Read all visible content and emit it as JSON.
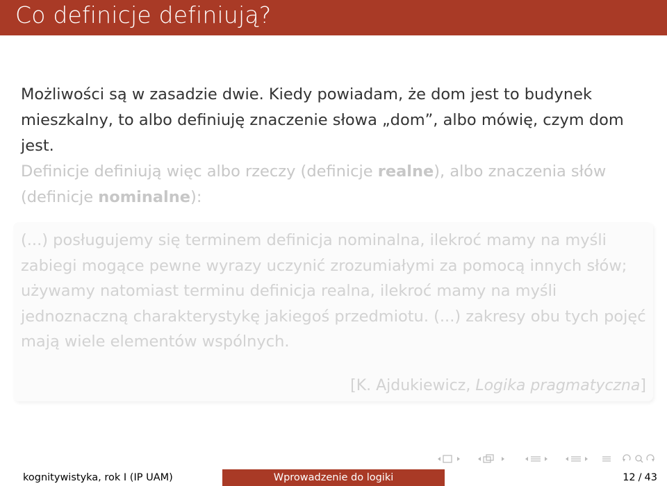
{
  "title": "Co definicje definiują?",
  "paragraph1": "Możliwości są w zasadzie dwie. Kiedy powiadam, że dom jest to budynek mieszkalny, to albo definiuję znaczenie słowa „dom”, albo mówię, czym dom jest.",
  "paragraph2": {
    "part1": "Definicje definiują więc albo rzeczy (definicje ",
    "bold1": "realne",
    "part2": "), albo znaczenia słów (definicje ",
    "bold2": "nominalne",
    "part3": "):"
  },
  "quote": {
    "text": "(...) posługujemy się terminem definicja nominalna, ilekroć mamy na myśli zabiegi mogące pewne wyrazy uczynić zrozumiałymi za pomocą innych słów; używamy natomiast terminu definicja realna, ilekroć mamy na myśli jednoznaczną charakterystykę jakiegoś przedmiotu. (...) zakresy obu tych pojęć mają wiele elementów wspólnych.",
    "source_prefix": "[K. Ajdukiewicz, ",
    "source_title": "Logika pragmatyczna",
    "source_suffix": "]"
  },
  "footer": {
    "left": "kognitywistyka, rok I  (IP UAM)",
    "center": "Wprowadzenie do logiki",
    "page_current": "12",
    "page_sep": "/",
    "page_total": "43"
  }
}
